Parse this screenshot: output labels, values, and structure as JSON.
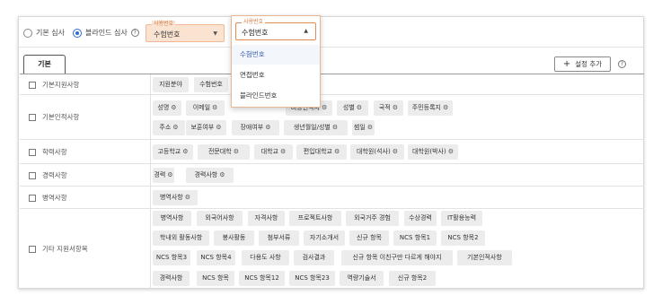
{
  "topbar": {
    "radio_basic": "기본 심사",
    "radio_blind": "블라인드 심사",
    "select1": {
      "label": "사용번호",
      "value": "수험번호"
    },
    "select2": {
      "label": "사용번호",
      "value": "수험번호"
    },
    "dropdown_options": [
      "수험번호",
      "면접번호",
      "블라인드번호"
    ]
  },
  "tab": "기본",
  "add_button": "설정 추가",
  "rows": [
    {
      "label": "기본지원사항",
      "chips": [
        "지원분야",
        "수험번호"
      ]
    },
    {
      "label": "기본인적사항",
      "chips": [
        "성명",
        "이메일",
        "비상연락처",
        "성별",
        "국적",
        "주민등록지",
        "주소",
        "보훈여부",
        "장애여부",
        "생년월일/성별",
        "썸일"
      ]
    },
    {
      "label": "학력사항",
      "chips": [
        "고등학교",
        "전문대학",
        "대학교",
        "편입대학교",
        "대학원(석사)",
        "대학원(박사)"
      ]
    },
    {
      "label": "경력사항",
      "chips": [
        "경력",
        "경력사항"
      ]
    },
    {
      "label": "병역사항",
      "chips": [
        "병역사항"
      ]
    },
    {
      "label": "기타 지원서항목",
      "chips": [
        "병역사항",
        "외국어사항",
        "자격사항",
        "프로젝트사항",
        "외국거주 경험",
        "수상경력",
        "IT활용능력",
        "학내외 활동사항",
        "봉사활동",
        "첨부서류",
        "자기소개서",
        "신규 항목",
        "NCS 항목1",
        "NCS 항목2",
        "NCS 항목3",
        "NCS 항목4",
        "다용도 사항",
        "검사결과",
        "신규 항목 이친구만 다르게 해야지",
        "기본인적사항",
        "경력사항",
        "NCS 항목",
        "NCS 항목12",
        "NCS 항목23",
        "역량기술서",
        "신규 항목2"
      ]
    }
  ]
}
